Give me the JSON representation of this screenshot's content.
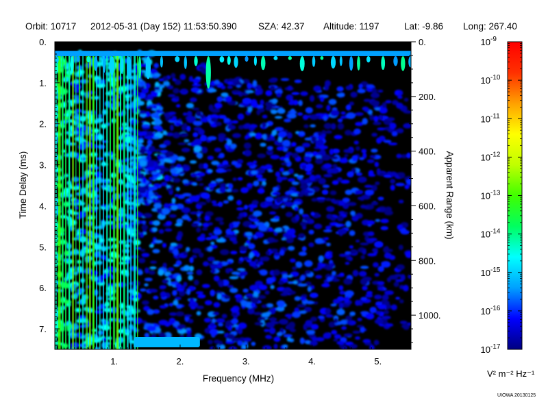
{
  "header": {
    "orbit": "Orbit: 10717",
    "datetime": "2012-05-31 (Day 152) 11:53:50.390",
    "sza": "SZA:  42.37",
    "altitude": "Altitude:     1197",
    "lat": "Lat:  -9.86",
    "long": "Long: 267.40"
  },
  "credit": "UIOWA 20130125",
  "colorbar": {
    "unit": "V² m⁻² Hz⁻¹",
    "tick_labels": [
      "10",
      "10",
      "10",
      "10",
      "10",
      "10",
      "10",
      "10",
      "10"
    ],
    "tick_exponents": [
      "-9",
      "-10",
      "-11",
      "-12",
      "-13",
      "-14",
      "-15",
      "-16",
      "-17"
    ],
    "exponent_values": [
      -9,
      -10,
      -11,
      -12,
      -13,
      -14,
      -15,
      -16,
      -17
    ],
    "range": [
      -17,
      -9
    ],
    "colors": [
      "#000080",
      "#0000ff",
      "#00a0ff",
      "#00ffff",
      "#00ff60",
      "#40ff00",
      "#c0ff00",
      "#ffff00",
      "#ffa000",
      "#ff3000",
      "#ff0000"
    ]
  },
  "chart_data": {
    "type": "heatmap",
    "xlabel": "Frequency (MHz)",
    "ylabel": "Time Delay (ms)",
    "y2label": "Apparent Range (km)",
    "xlim": [
      0.1,
      5.5
    ],
    "ylim": [
      0.0,
      7.5
    ],
    "y2lim": [
      0,
      1125
    ],
    "x_ticks": [
      1,
      2,
      3,
      4,
      5
    ],
    "x_tick_labels": [
      "1.",
      "2.",
      "3.",
      "4.",
      "5."
    ],
    "y_ticks": [
      0,
      1,
      2,
      3,
      4,
      5,
      6,
      7
    ],
    "y_tick_labels": [
      "0.",
      "1.",
      "2.",
      "3.",
      "4.",
      "5.",
      "6.",
      "7."
    ],
    "y2_ticks": [
      0,
      200,
      400,
      600,
      800,
      1000
    ],
    "y2_tick_labels": [
      "0.",
      "200.",
      "400.",
      "600.",
      "800.",
      "1000."
    ],
    "background_color": "#000000",
    "regions": [
      {
        "freq": [
          0.1,
          0.35
        ],
        "delay": [
          0.25,
          7.5
        ],
        "level": -14.5
      },
      {
        "freq": [
          0.35,
          1.35
        ],
        "delay": [
          0.25,
          7.5
        ],
        "level": -15.3
      },
      {
        "freq": [
          1.35,
          1.7
        ],
        "delay": [
          0.25,
          4.0
        ],
        "level": -15.8
      },
      {
        "freq": [
          1.3,
          2.3
        ],
        "delay": [
          0.8,
          7.3
        ],
        "level": -16.3
      },
      {
        "freq": [
          2.3,
          2.45
        ],
        "delay": [
          0.5,
          7.2
        ],
        "level": -17.0
      },
      {
        "freq": [
          2.45,
          3.8
        ],
        "delay": [
          0.9,
          7.5
        ],
        "level": -16.4
      },
      {
        "freq": [
          3.8,
          5.0
        ],
        "delay": [
          1.0,
          7.5
        ],
        "level": -16.6
      },
      {
        "freq": [
          5.0,
          5.5
        ],
        "delay": [
          1.2,
          7.0
        ],
        "level": -16.9
      }
    ],
    "features": [
      {
        "name": "top-spike-band",
        "freq": [
          0.1,
          5.5
        ],
        "delay": [
          0.22,
          0.35
        ],
        "level": -15.0
      },
      {
        "name": "bottom-ground-echo",
        "freq": [
          1.3,
          2.3
        ],
        "delay": [
          7.2,
          7.45
        ],
        "level": -15.2
      },
      {
        "name": "low-freq-green-stripes",
        "freq": [
          0.1,
          1.35
        ],
        "delay": [
          0.25,
          7.5
        ],
        "level": -13.8
      }
    ]
  }
}
